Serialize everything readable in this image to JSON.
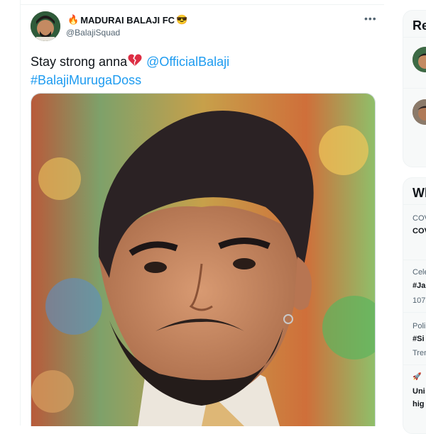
{
  "tweet": {
    "display_name": "MADURAI BALAJI FC",
    "handle": "@BalajiSquad",
    "more_label": "•••",
    "text_line1": "Stay strong anna",
    "mention": "@OfficialBalaji",
    "hashtag": "#BalajiMurugaDoss"
  },
  "sidebar": {
    "relevant_heading": "Re",
    "trends_heading": "Wh",
    "trends": [
      {
        "category": "COV",
        "title": "COV"
      },
      {
        "category": "Cele",
        "title": "#Ja",
        "count": "107"
      },
      {
        "category": "Poli",
        "title": "#Si",
        "count": "Tren"
      },
      {
        "category": "",
        "title": "Uni",
        "title2": "hig"
      }
    ]
  },
  "icons": {
    "fire": "fire-emoji",
    "sunglasses": "sunglasses-emoji",
    "broken_heart": "broken-heart-emoji"
  },
  "colors": {
    "link": "#1d9bf0",
    "muted": "#536471",
    "border": "#eff3f4"
  }
}
